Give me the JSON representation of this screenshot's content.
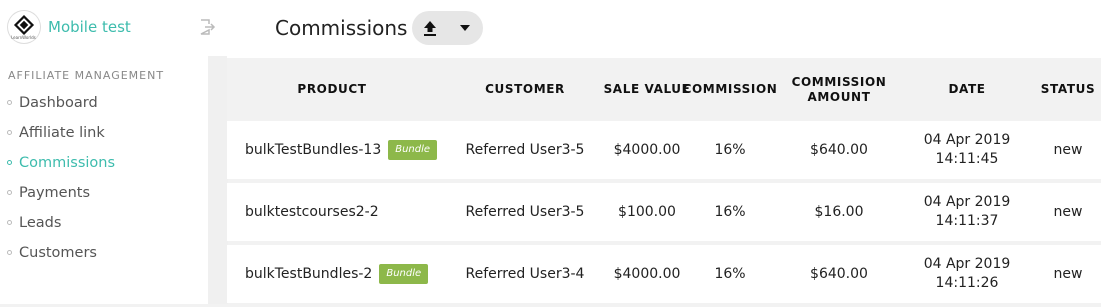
{
  "app": {
    "brand_name": "Mobile test",
    "logo_text": "LearnWorlds"
  },
  "sidebar": {
    "section_title": "AFFILIATE MANAGEMENT",
    "items": [
      {
        "label": "Dashboard",
        "active": false
      },
      {
        "label": "Affiliate link",
        "active": false
      },
      {
        "label": "Commissions",
        "active": true
      },
      {
        "label": "Payments",
        "active": false
      },
      {
        "label": "Leads",
        "active": false
      },
      {
        "label": "Customers",
        "active": false
      }
    ]
  },
  "header": {
    "title": "Commissions",
    "export_icon": "upload-icon",
    "dropdown_icon": "caret-down-icon"
  },
  "table": {
    "columns": {
      "product": "PRODUCT",
      "customer": "CUSTOMER",
      "sale_value": "SALE VALUE",
      "commission": "COMMISSION",
      "commission_amount": "COMMISSION AMOUNT",
      "date": "DATE",
      "status": "STATUS"
    },
    "rows": [
      {
        "product": "bulkTestBundles-13",
        "badge": "Bundle",
        "customer": "Referred User3-5",
        "sale_value": "$4000.00",
        "commission": "16%",
        "amount": "$640.00",
        "date": "04 Apr 2019",
        "time": "14:11:45",
        "status": "new"
      },
      {
        "product": "bulktestcourses2-2",
        "badge": "",
        "customer": "Referred User3-5",
        "sale_value": "$100.00",
        "commission": "16%",
        "amount": "$16.00",
        "date": "04 Apr 2019",
        "time": "14:11:37",
        "status": "new"
      },
      {
        "product": "bulkTestBundles-2",
        "badge": "Bundle",
        "customer": "Referred User3-4",
        "sale_value": "$4000.00",
        "commission": "16%",
        "amount": "$640.00",
        "date": "04 Apr 2019",
        "time": "14:11:26",
        "status": "new"
      }
    ]
  },
  "colors": {
    "accent": "#3dbcad",
    "badge": "#8db84a"
  }
}
